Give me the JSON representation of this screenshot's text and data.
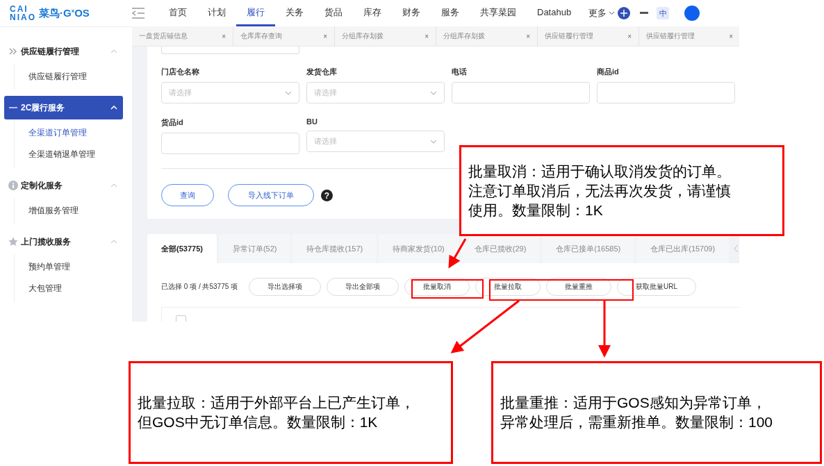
{
  "logo": {
    "line_1": "CAI",
    "line_2": "NIAO",
    "brand": "菜鸟·G$^{x}$OS"
  },
  "top_nav": {
    "items": [
      {
        "label": "首页",
        "selected": false
      },
      {
        "label": "计划",
        "selected": false
      },
      {
        "label": "履行",
        "selected": true
      },
      {
        "label": "关务",
        "selected": false
      },
      {
        "label": "货品",
        "selected": false
      },
      {
        "label": "库存",
        "selected": false
      },
      {
        "label": "财务",
        "selected": false
      },
      {
        "label": "服务",
        "selected": false
      },
      {
        "label": "共享菜园",
        "selected": false
      },
      {
        "label": "Datahub",
        "selected": false
      }
    ],
    "more": "更多",
    "language": "中"
  },
  "page_tabs": [
    {
      "label": "一盘货店铺信息",
      "close": "×"
    },
    {
      "label": "仓库库存查询",
      "close": "×"
    },
    {
      "label": "分组库存划拨",
      "close": "×"
    },
    {
      "label": "分组库存划拨",
      "close": "×"
    },
    {
      "label": "供应链履行管理",
      "close": "×"
    },
    {
      "label": "供应链履行管理",
      "close": "×"
    }
  ],
  "sidebar": [
    {
      "title": "供应链履行管理",
      "kind": "chevrons",
      "expanded": true,
      "selected": false,
      "children": [
        {
          "label": "供应链履行管理",
          "selected": false
        }
      ]
    },
    {
      "title": "2C履行服务",
      "kind": "dash",
      "expanded": true,
      "selected": true,
      "children": [
        {
          "label": "全渠道订单管理",
          "selected": true
        },
        {
          "label": "全渠道销退单管理",
          "selected": false
        }
      ]
    },
    {
      "title": "定制化服务",
      "kind": "info",
      "expanded": true,
      "selected": false,
      "children": [
        {
          "label": "增值服务管理",
          "selected": false
        }
      ]
    },
    {
      "title": "上门揽收服务",
      "kind": "star",
      "expanded": true,
      "selected": false,
      "children": [
        {
          "label": "预约单管理",
          "selected": false
        },
        {
          "label": "大包管理",
          "selected": false
        }
      ]
    }
  ],
  "form": {
    "rows": [
      [
        {
          "label": "门店仓名称",
          "kind": "select",
          "placeholder": "请选择"
        },
        {
          "label": "发货仓库",
          "kind": "select",
          "placeholder": "请选择"
        },
        {
          "label": "电话",
          "kind": "input"
        },
        {
          "label": "商品id",
          "kind": "input"
        }
      ],
      [
        {
          "label": "货品id",
          "kind": "input"
        },
        {
          "label": "BU",
          "kind": "select",
          "placeholder": "请选择"
        }
      ]
    ],
    "buttons": [
      "查询",
      "导入线下订单"
    ],
    "help": "?"
  },
  "status_tabs": [
    {
      "label": "全部(53775)",
      "selected": true
    },
    {
      "label": "异常订单(52)",
      "selected": false
    },
    {
      "label": "待仓库揽收(157)",
      "selected": false
    },
    {
      "label": "待商家发货(10)",
      "selected": false
    },
    {
      "label": "仓库已揽收(29)",
      "selected": false
    },
    {
      "label": "仓库已接单(16585)",
      "selected": false
    },
    {
      "label": "仓库已出库(15709)",
      "selected": false
    }
  ],
  "selection_summary": "已选择 0 项 / 共53775 项",
  "actions": [
    "导出选择项",
    "导出全部项",
    "批量取消",
    "批量拉取",
    "批量重推",
    "获取批量URL"
  ],
  "table": {
    "select_all_checked": false
  },
  "callouts": [
    {
      "lines": [
        "批量取消：适用于确认取消发货的订单。",
        "注意订单取消后，无法再次发货，请谨慎",
        "使用。数量限制：1K"
      ]
    },
    {
      "lines": [
        "批量拉取：适用于外部平台上已产生订单，",
        "但GOS中无订单信息。数量限制：1K"
      ]
    },
    {
      "lines": [
        "批量重推：适用于GOS感知为异常订单，",
        "异常处理后，需重新推单。数量限制：100"
      ]
    }
  ]
}
